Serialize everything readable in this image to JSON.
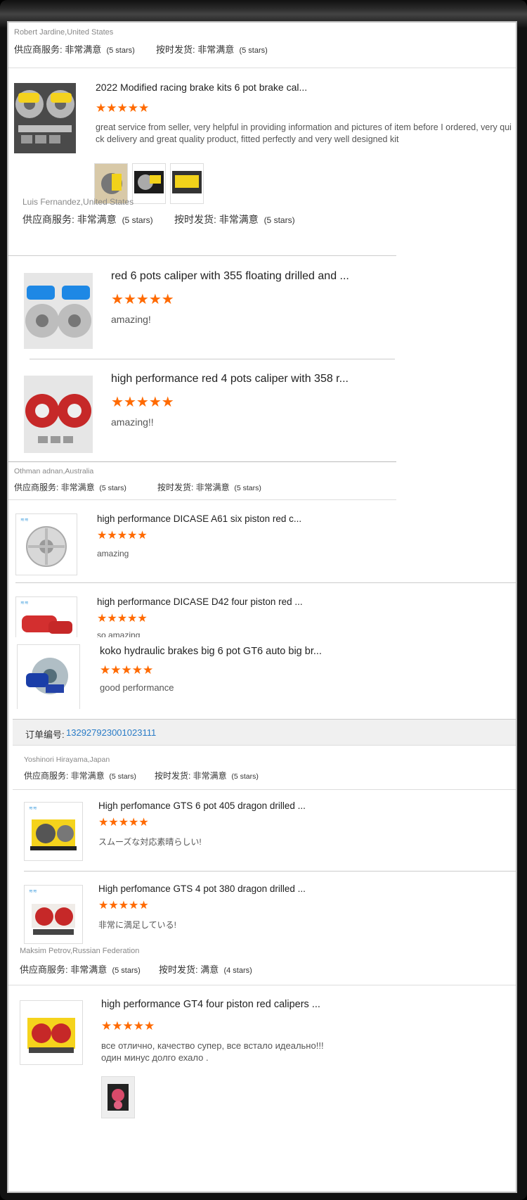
{
  "labels": {
    "supplier_service": "供应商服务: 非常满意",
    "on_time": "按时发货: 非常满意",
    "on_time_4": "按时发货: 满意",
    "five_stars": "(5 stars)",
    "four_stars": "(4 stars)"
  },
  "reviews": [
    {
      "reviewer": "Robert Jardine,United States",
      "product": "2022 Modified racing brake kits 6 pot brake cal...",
      "comment": "great service from seller, very helpful in providing information and pictures of item before I ordered, very quick delivery and great quality product, fitted perfectly and very well designed kit"
    },
    {
      "reviewer": "Luis Fernandez,United States",
      "products": [
        {
          "title": "red 6 pots caliper with 355 floating drilled and ...",
          "comment": "amazing!"
        },
        {
          "title": "high performance red 4 pots caliper with 358 r...",
          "comment": "amazing!!"
        }
      ]
    },
    {
      "reviewer": "Othman adnan,Australia",
      "products": [
        {
          "title": "high performance DICASE A61 six piston red c...",
          "comment": "amazing"
        },
        {
          "title": "high performance DICASE D42 four piston red ...",
          "comment": "so amazing"
        }
      ]
    },
    {
      "title": "koko hydraulic brakes big 6 pot GT6 auto big br...",
      "comment": "good performance"
    },
    {
      "order_label": "订单编号:",
      "order_number": "132927923001023111",
      "reviewer": "Yoshinori Hirayama,Japan",
      "products": [
        {
          "title": "High perfomance GTS 6 pot 405 dragon drilled ...",
          "comment": "スムーズな対応素晴らしい!"
        },
        {
          "title": "High perfomance GTS 4 pot 380 dragon drilled ...",
          "comment": "非常に満足している!"
        }
      ]
    },
    {
      "reviewer": "Maksim Petrov,Russian Federation",
      "product": "high performance GT4 four piston red calipers ...",
      "comment_line1": "все отлично, качество супер, все встало идеально!!!",
      "comment_line2": "один минус долго ехало ."
    }
  ],
  "colors": {
    "star": "#ff6a00",
    "link": "#2a7cc7",
    "order_bar": "#f0f0f0"
  },
  "icons": {
    "star": "star-icon"
  }
}
